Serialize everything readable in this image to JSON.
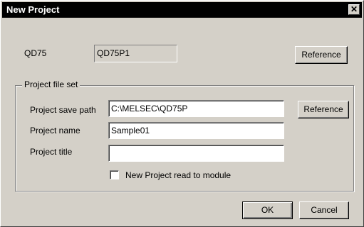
{
  "window": {
    "title": "New Project",
    "close_glyph": "✕"
  },
  "module": {
    "label": "QD75",
    "value": "QD75P1",
    "reference_label": "Reference"
  },
  "project_file_set": {
    "caption": "Project file set",
    "save_path_label": "Project save path",
    "save_path_value": "C:\\MELSEC\\QD75P",
    "reference_label": "Reference",
    "name_label": "Project name",
    "name_value": "Sample01",
    "title_label": "Project title",
    "title_value": "",
    "read_to_module_label": "New Project read to module",
    "read_to_module_checked": false
  },
  "buttons": {
    "ok_label": "OK",
    "cancel_label": "Cancel"
  },
  "colors": {
    "dialog_background": "#d4d0c8",
    "titlebar_background": "#000000",
    "titlebar_text": "#ffffff"
  }
}
